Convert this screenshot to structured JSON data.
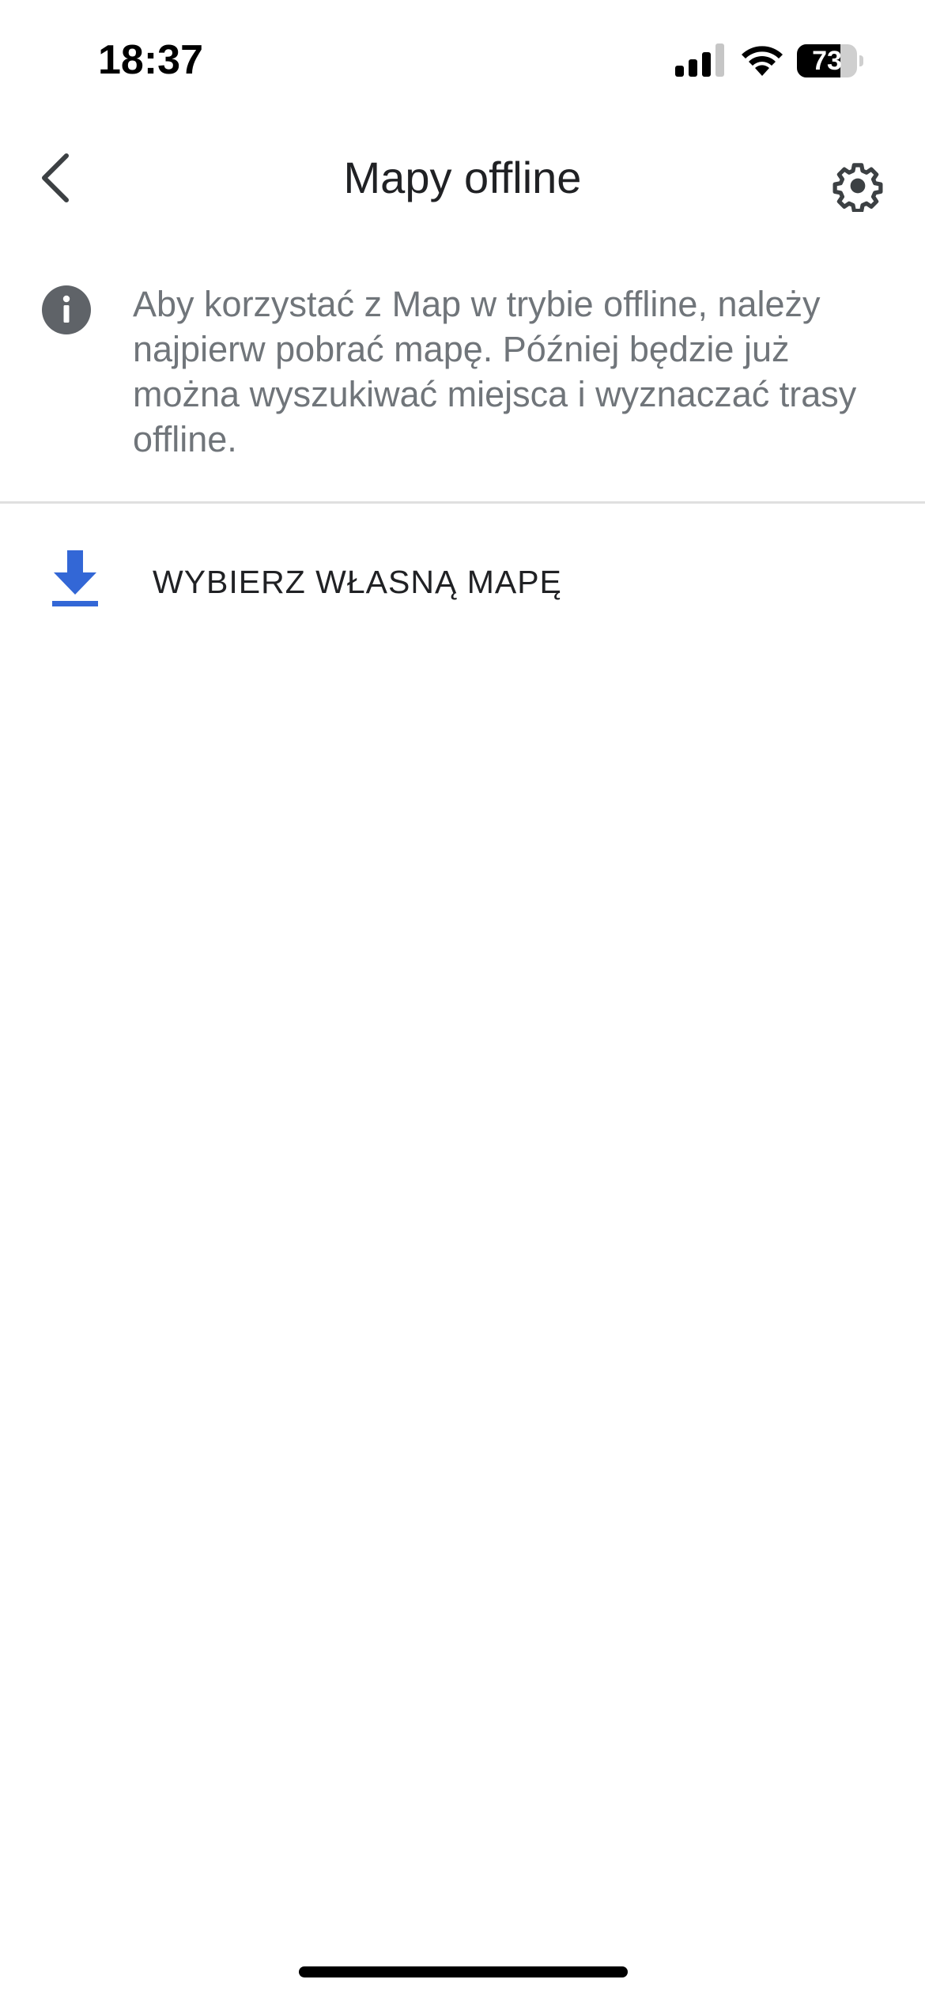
{
  "status_bar": {
    "time": "18:37",
    "battery_percent": 73,
    "battery_label": "73",
    "signal_icon": "cellular-signal-icon",
    "wifi_icon": "wifi-icon"
  },
  "header": {
    "title": "Mapy offline",
    "back_icon": "chevron-left-icon",
    "settings_icon": "gear-icon"
  },
  "info": {
    "icon": "info-icon",
    "text": "Aby korzystać z Map w trybie offline, należy najpierw pobrać mapę. Później będzie już można wyszukiwać miejsca i wyznaczać trasy offline."
  },
  "actions": {
    "select_map_label": "WYBIERZ WŁASNĄ MAPĘ",
    "select_map_icon": "download-icon"
  },
  "colors": {
    "accent": "#3367d6",
    "text_primary": "#202124",
    "text_secondary": "#70757a",
    "icon_gray": "#5f6368",
    "divider": "#e0e0e0"
  }
}
